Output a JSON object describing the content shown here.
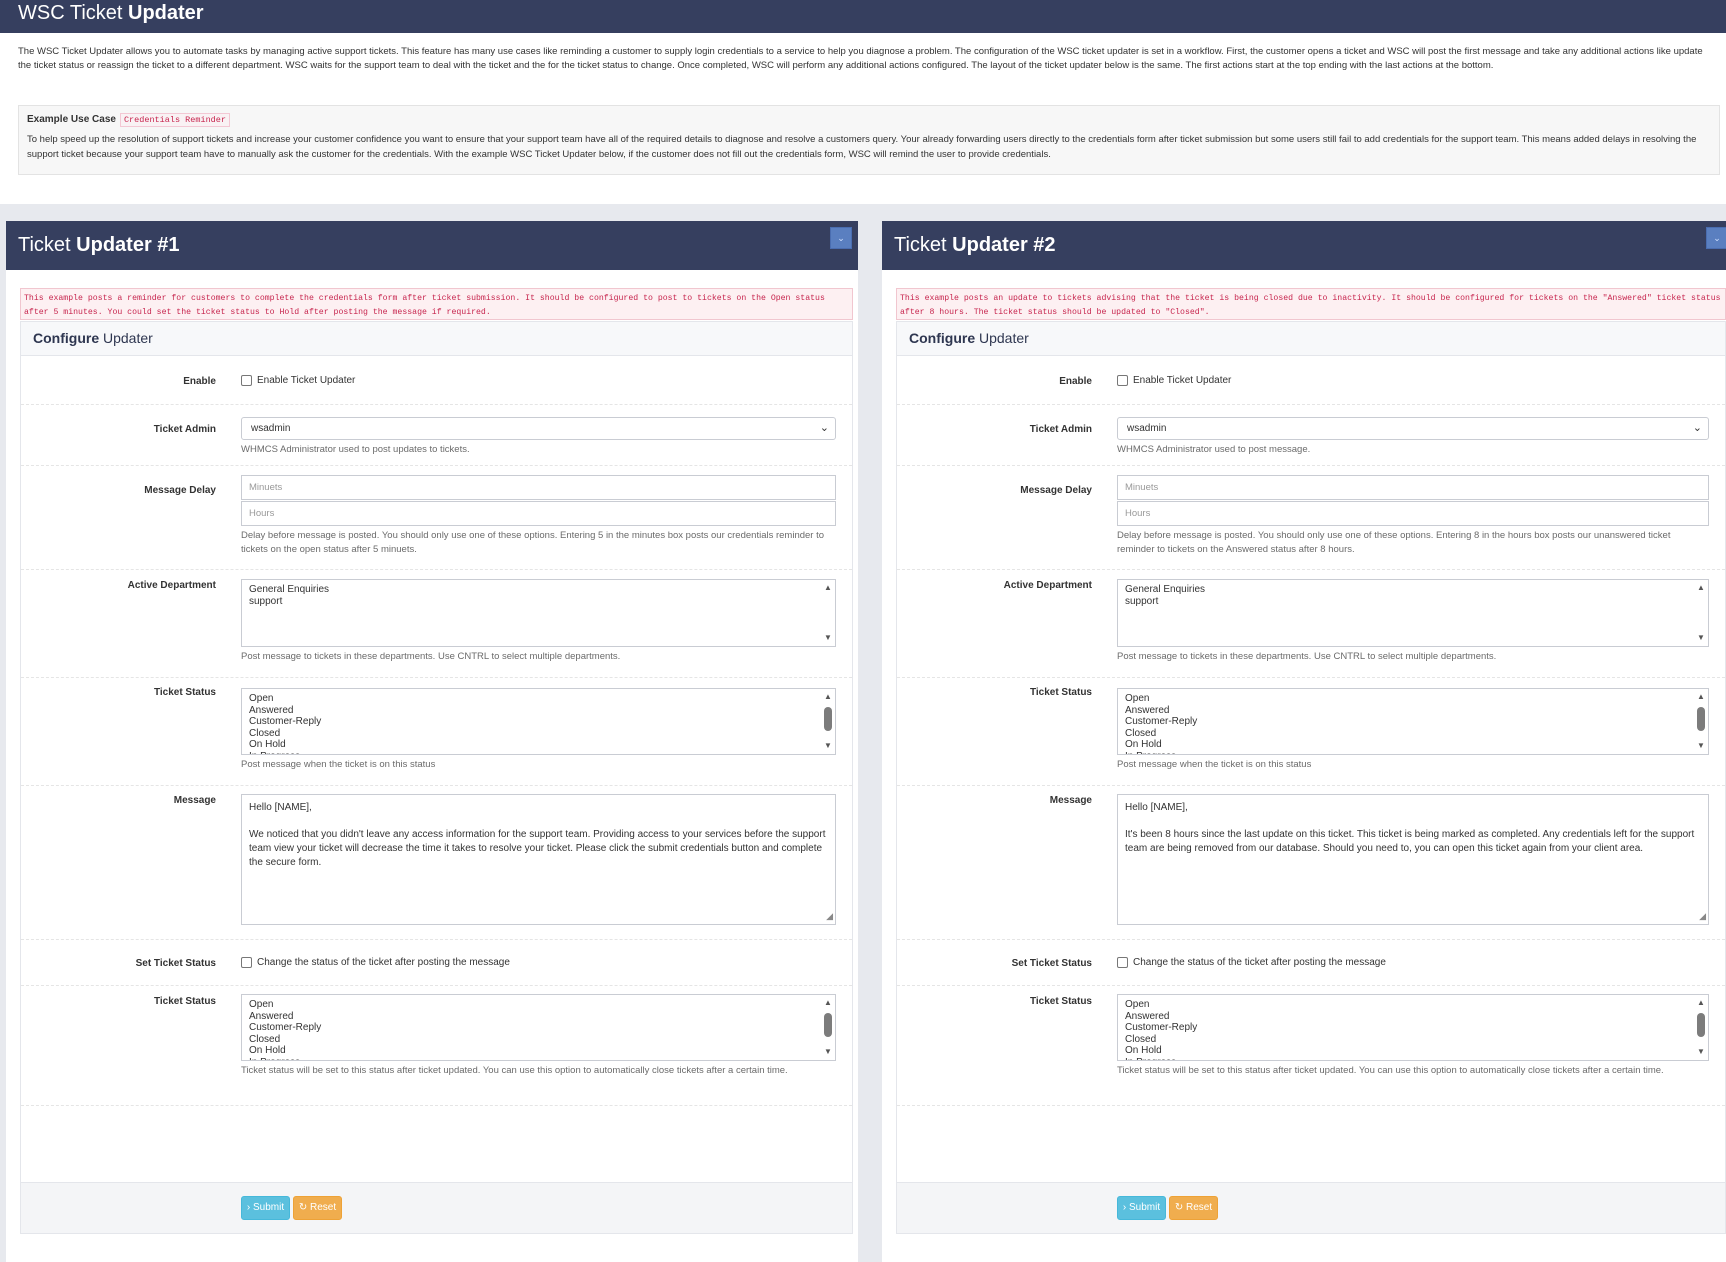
{
  "page": {
    "title_light": "WSC Ticket",
    "title_bold": "Updater",
    "intro": "The WSC Ticket Updater allows you to automate tasks by managing active support tickets. This feature has many use cases like reminding a customer to supply login credentials to a service to help you diagnose a problem. The configuration of the WSC ticket updater is set in a workflow. First, the customer opens a ticket and WSC will post the first message and take any additional actions like update the ticket status or reassign the ticket to a different department. WSC waits for the support team to deal with the ticket and the for the ticket status to change. Once completed, WSC will perform any additional actions configured. The layout of the ticket updater below is the same. The first actions start at the top ending with the last actions at the bottom.",
    "example_title": "Example Use Case",
    "example_tag": "Credentials Reminder",
    "example_body": "To help speed up the resolution of support tickets and increase your customer confidence you want to ensure that your support team have all of the required details to diagnose and resolve a customers query. Your already forwarding users directly to the credentials form after ticket submission but some users still fail to add credentials for the support team. This means added delays in resolving the support ticket because your support team have to manually ask the customer for the credentials. With the example WSC Ticket Updater below, if the customer does not fill out the credentials form, WSC will remind the user to provide credentials."
  },
  "panels": [
    {
      "title_light": "Ticket",
      "title_bold": "Updater #1",
      "collapse_icon": "chevron-down-icon",
      "note": "This example posts a reminder for customers to complete the credentials form after ticket submission. It should be configured to post to tickets on the Open status after 5 minutes. You could set the ticket status to Hold after posting the message if required.",
      "config_bold": "Configure",
      "config_light": "Updater",
      "labels": {
        "enable": "Enable",
        "ticket_admin": "Ticket Admin",
        "message_delay": "Message Delay",
        "active_department": "Active Department",
        "ticket_status": "Ticket Status",
        "message": "Message",
        "set_ticket_status": "Set Ticket Status",
        "ticket_status_after": "Ticket Status"
      },
      "enable_text": "Enable Ticket Updater",
      "admin_value": "wsadmin",
      "admin_help": "WHMCS Administrator used to post updates to tickets.",
      "minutes_placeholder": "Minuets",
      "hours_placeholder": "Hours",
      "delay_help": "Delay before message is posted. You should only use one of these options. Entering 5 in the minutes box posts our credentials reminder to tickets on the open status after 5 minuets.",
      "departments": [
        "General Enquiries",
        "support"
      ],
      "dept_help": "Post message to tickets in these departments. Use CNTRL to select multiple departments.",
      "statuses": [
        "Open",
        "Answered",
        "Customer-Reply",
        "Closed",
        "On Hold",
        "In Progress"
      ],
      "status_help": "Post message when the ticket is on this status",
      "message_lines": [
        "Hello [NAME],",
        "We noticed that you didn't leave any access information for the support team. Providing access to your services before the support team view your ticket will decrease the time it takes to resolve your ticket. Please click the submit credentials button and complete the secure form."
      ],
      "set_status_text": "Change the status of the ticket after posting the message",
      "after_statuses": [
        "Open",
        "Answered",
        "Customer-Reply",
        "Closed",
        "On Hold",
        "In Progress"
      ],
      "after_help": "Ticket status will be set to this status after ticket updated. You can use this option to automatically close tickets after a certain time.",
      "submit": "› Submit",
      "reset": "↻ Reset"
    },
    {
      "title_light": "Ticket",
      "title_bold": "Updater #2",
      "collapse_icon": "chevron-down-icon",
      "note": "This example posts an update to tickets advising that the ticket is being closed due to inactivity. It should be configured for tickets on the \"Answered\" ticket status after 8 hours. The ticket status should be updated to \"Closed\".",
      "config_bold": "Configure",
      "config_light": "Updater",
      "labels": {
        "enable": "Enable",
        "ticket_admin": "Ticket Admin",
        "message_delay": "Message Delay",
        "active_department": "Active Department",
        "ticket_status": "Ticket Status",
        "message": "Message",
        "set_ticket_status": "Set Ticket Status",
        "ticket_status_after": "Ticket Status"
      },
      "enable_text": "Enable Ticket Updater",
      "admin_value": "wsadmin",
      "admin_help": "WHMCS Administrator used to post message.",
      "minutes_placeholder": "Minuets",
      "hours_placeholder": "Hours",
      "delay_help": "Delay before message is posted. You should only use one of these options. Entering 8 in the hours box posts our unanswered ticket reminder to tickets on the Answered status after 8 hours.",
      "departments": [
        "General Enquiries",
        "support"
      ],
      "dept_help": "Post message to tickets in these departments. Use CNTRL to select multiple departments.",
      "statuses": [
        "Open",
        "Answered",
        "Customer-Reply",
        "Closed",
        "On Hold",
        "In Progress"
      ],
      "status_help": "Post message when the ticket is on this status",
      "message_lines": [
        "Hello [NAME],",
        "It's been 8 hours since the last update on this ticket. This ticket is being marked as completed. Any credentials left for the support team are being removed from our database. Should you need to, you can open this ticket again from your client area."
      ],
      "set_status_text": "Change the status of the ticket after posting the message",
      "after_statuses": [
        "Open",
        "Answered",
        "Customer-Reply",
        "Closed",
        "On Hold",
        "In Progress"
      ],
      "after_help": "Ticket status will be set to this status after ticket updated. You can use this option to automatically close tickets after a certain time.",
      "submit": "› Submit",
      "reset": "↻ Reset"
    }
  ]
}
